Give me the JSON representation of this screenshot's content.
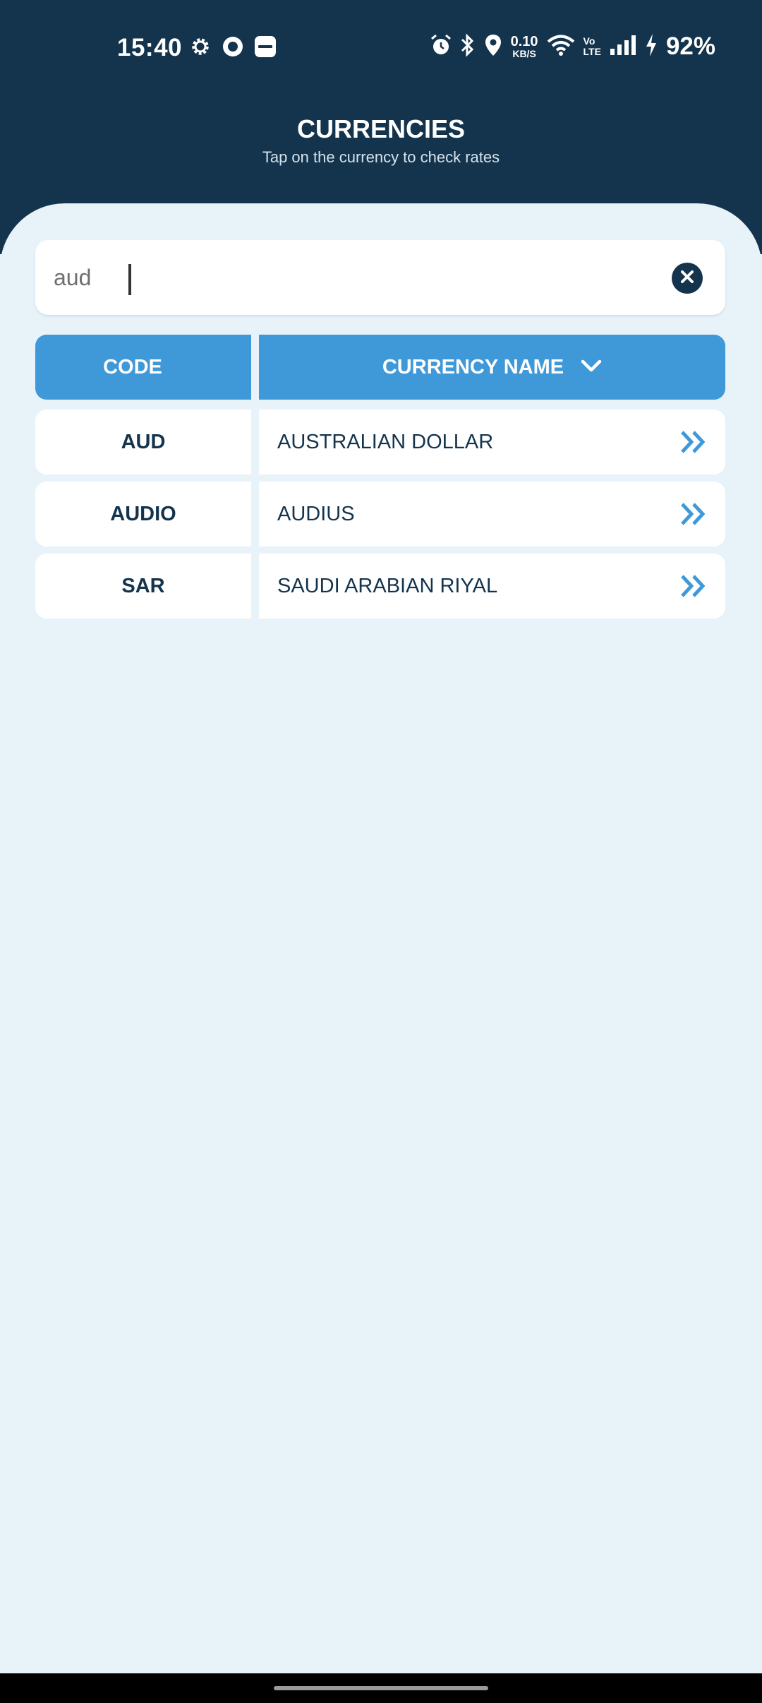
{
  "status_bar": {
    "time": "15:40",
    "left_icons": [
      "settings-gear-icon",
      "circle-record-icon",
      "paytm-icon"
    ],
    "net_speed_value": "0.10",
    "net_speed_unit": "KB/S",
    "volte_top": "Vo",
    "volte_bottom": "LTE",
    "battery_percent": "92%",
    "right_icons": [
      "alarm-icon",
      "bluetooth-icon",
      "location-icon",
      "wifi-icon",
      "signal-icon",
      "charging-icon"
    ]
  },
  "header": {
    "title": "CURRENCIES",
    "subtitle": "Tap on the currency to check rates"
  },
  "search": {
    "value": "aud",
    "clear_icon": "close-icon"
  },
  "table": {
    "code_header": "CODE",
    "name_header": "CURRENCY NAME",
    "sort_icon": "chevron-down-icon",
    "rows": [
      {
        "code": "AUD",
        "name": "AUSTRALIAN DOLLAR"
      },
      {
        "code": "AUDIO",
        "name": "AUDIUS"
      },
      {
        "code": "SAR",
        "name": "SAUDI ARABIAN RIYAL"
      }
    ]
  },
  "colors": {
    "header_bg": "#14344d",
    "accent": "#3f98d8",
    "page_bg": "#e8f2f9",
    "text_dark": "#14344d"
  }
}
